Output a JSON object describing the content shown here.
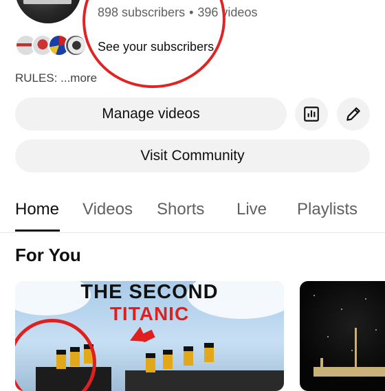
{
  "channel": {
    "subscribers": "898 subscribers",
    "separator": "•",
    "videos": "396 videos",
    "see_subscribers": "See your subscribers",
    "rules": "RULES: ...more"
  },
  "actions": {
    "manage_videos": "Manage videos",
    "visit_community": "Visit Community",
    "analytics_icon": "analytics-icon",
    "edit_icon": "pencil-icon"
  },
  "tabs": [
    {
      "label": "Home",
      "active": true
    },
    {
      "label": "Videos",
      "active": false
    },
    {
      "label": "Shorts",
      "active": false
    },
    {
      "label": "Live",
      "active": false
    },
    {
      "label": "Playlists",
      "active": false
    }
  ],
  "section": {
    "title": "For You"
  },
  "videos": [
    {
      "thumb_line1": "THE SECOND",
      "thumb_line2": "TITANIC"
    },
    {
      "thumb_line1": "",
      "thumb_line2": ""
    }
  ],
  "colors": {
    "annotation": "#e02424",
    "pill_bg": "#f2f2f2",
    "thumb_accent": "#e01f1f"
  }
}
